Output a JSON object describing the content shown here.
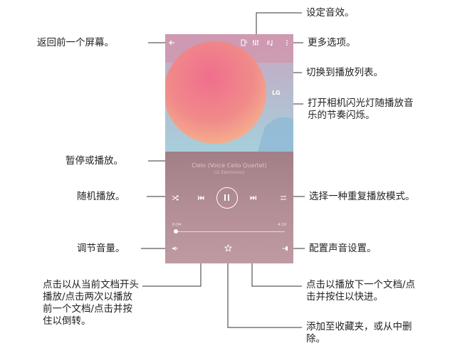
{
  "labels": {
    "back": "返回前一个屏幕。",
    "sound_effects": "设定音效。",
    "more_options": "更多选项。",
    "switch_playlist": "切换到播放列表。",
    "flash": "打开相机闪光灯随播放音乐的节奏闪烁。",
    "pause_play": "暂停或播放。",
    "shuffle": "随机播放。",
    "repeat_mode": "选择一种重复播放模式。",
    "volume": "调节音量。",
    "sound_settings": "配置声音设置。",
    "previous": "点击以从当前文档开头播放/点击两次以播放前一个文档/点击并按住以倒转。",
    "next": "点击以播放下一个文档/点击并按住以快进。",
    "favorite": "添加至收藏夹，或从中删除。"
  },
  "player": {
    "logo": "LG",
    "song_title": "Cielo (Voice Cello Quartet)",
    "song_artist": "LG Electronics",
    "time_elapsed": "0:04",
    "time_total": "4:10",
    "progress_fraction": 0.02
  },
  "icons": {
    "back": "back-arrow-icon",
    "flash": "flash-icon",
    "equalizer": "equalizer-icon",
    "playlist": "playlist-icon",
    "more": "more-vertical-icon",
    "shuffle": "shuffle-icon",
    "previous": "previous-icon",
    "pause": "pause-icon",
    "next": "next-icon",
    "repeat": "repeat-icon",
    "volume": "volume-icon",
    "favorite": "star-icon",
    "sound_settings": "sound-settings-icon"
  },
  "colors": {
    "line": "#333333",
    "art_bg": "#a9d4df",
    "art_pink": "#ef7a92",
    "art_orange": "#f4ad8d",
    "player_bg": "#b08b93"
  }
}
